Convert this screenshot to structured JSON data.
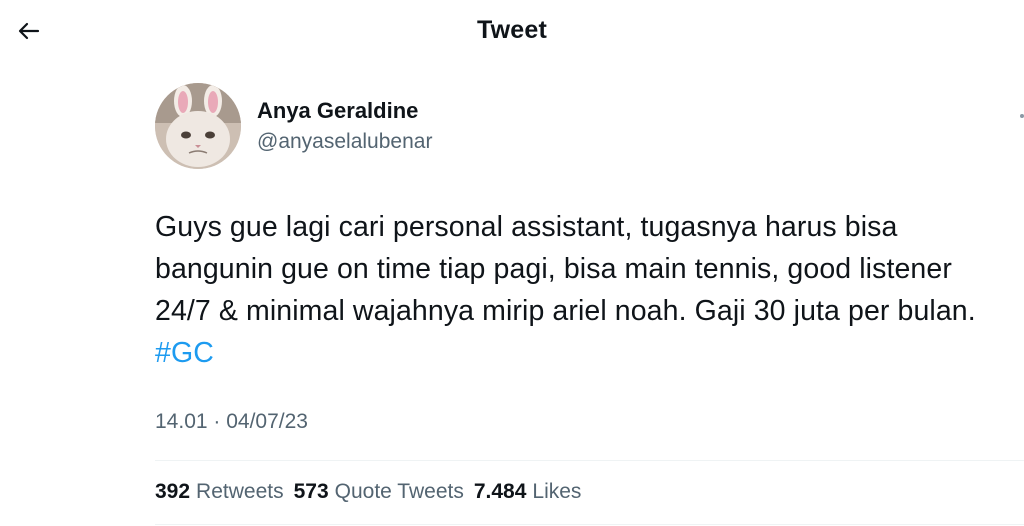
{
  "header": {
    "title": "Tweet"
  },
  "author": {
    "name": "Anya Geraldine",
    "handle": "@anyaselalubenar"
  },
  "tweet": {
    "text_before": "Guys gue lagi cari personal assistant, tugasnya harus bisa bangunin gue on time tiap pagi, bisa main tennis, good listener 24/7 & minimal wajahnya mirip ariel noah. Gaji 30 juta per bulan. ",
    "hashtag": "#GC",
    "timestamp": "14.01 · 04/07/23"
  },
  "stats": {
    "retweets_count": "392",
    "retweets_label": "Retweets",
    "quote_count": "573",
    "quote_label": "Quote Tweets",
    "likes_count": "7.484",
    "likes_label": "Likes"
  },
  "colors": {
    "accent": "#1d9bf0",
    "secondary_text": "#536471",
    "primary_text": "#0f1419",
    "divider": "#eff3f4"
  },
  "icons": {
    "back": "arrow-left-icon",
    "more": "more-dots-icon"
  }
}
